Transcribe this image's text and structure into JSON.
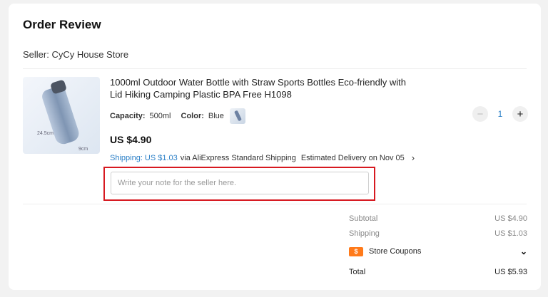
{
  "header": {
    "title": "Order Review"
  },
  "seller": {
    "label": "Seller: CyCy House Store"
  },
  "product": {
    "name": "1000ml Outdoor Water Bottle with Straw Sports Bottles Eco-friendly with Lid Hiking Camping Plastic BPA Free H1098",
    "capacity_label": "Capacity:",
    "capacity_value": "500ml",
    "color_label": "Color:",
    "color_value": "Blue",
    "price": "US $4.90",
    "shipping_link": "Shipping: US $1.03",
    "shipping_method": "via AliExpress Standard Shipping",
    "delivery": "Estimated Delivery on Nov 05",
    "quantity": "1",
    "image_dim_height": "24.5cm",
    "image_dim_width": "9cm"
  },
  "note": {
    "placeholder": "Write your note for the seller here."
  },
  "summary": {
    "subtotal_label": "Subtotal",
    "subtotal_value": "US $4.90",
    "shipping_label": "Shipping",
    "shipping_value": "US $1.03",
    "coupon_icon": "$",
    "coupon_label": "Store Coupons",
    "total_label": "Total",
    "total_value": "US $5.93"
  },
  "icons": {
    "minus": "−",
    "plus": "+",
    "chevron_right": "›",
    "chevron_down": "⌄"
  },
  "colors": {
    "highlight": "#d71920",
    "link": "#2a7fc7",
    "coupon": "#ff7a1a"
  }
}
